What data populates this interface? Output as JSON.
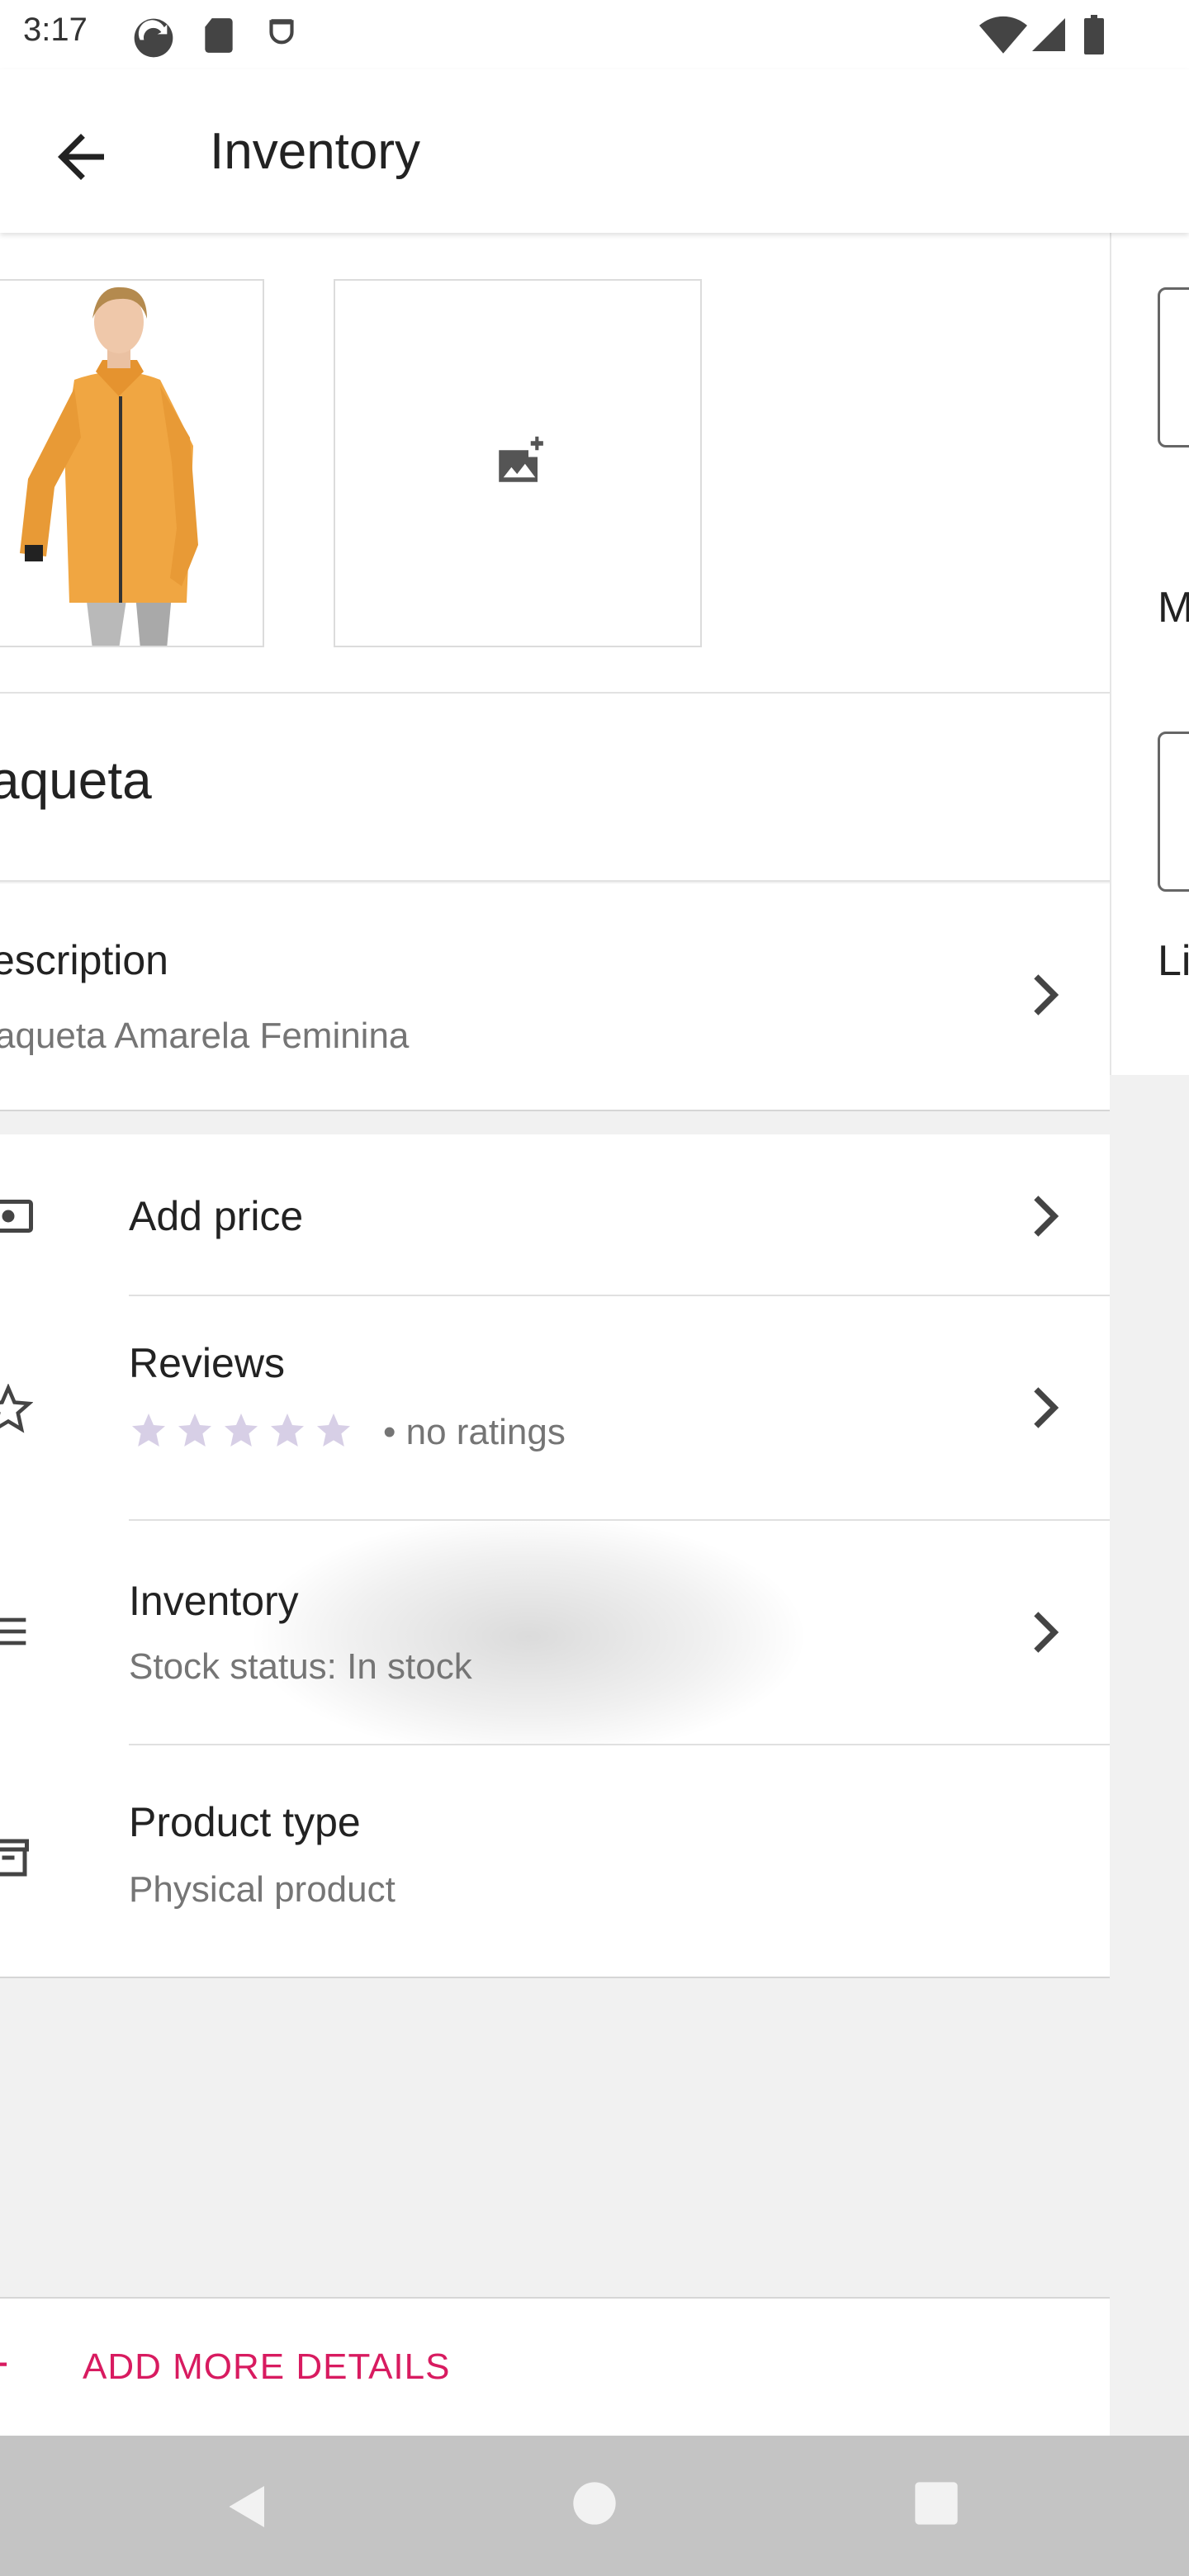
{
  "status_bar": {
    "time": "3:17",
    "icons": [
      "sync-icon",
      "sd-card-icon",
      "shield-icon",
      "wifi-icon",
      "signal-icon",
      "battery-icon"
    ]
  },
  "app_bar": {
    "title": "Inventory",
    "back_icon": "arrow-back-icon"
  },
  "photos": {
    "add_photo_icon": "add-photo-icon"
  },
  "product": {
    "title": "aqueta",
    "description_label": "escription",
    "description_value": "aqueta Amarela Feminina"
  },
  "rows": [
    {
      "label": "Add price",
      "icon": "price-tag-icon"
    },
    {
      "label": "Reviews",
      "icon": "star-outline-icon",
      "stars": 5,
      "ratings_text": "• no ratings"
    },
    {
      "label": "Inventory",
      "icon": "list-icon",
      "sub": "Stock status: In stock"
    },
    {
      "label": "Product type",
      "icon": "archive-icon",
      "sub": "Physical product"
    }
  ],
  "footer": {
    "add_more_label": "ADD MORE DETAILS",
    "plus": "+"
  },
  "right_panel": {
    "text_1": "M",
    "text_2": "Li"
  },
  "colors": {
    "accent": "#d81b60",
    "star": "#d7cfe6",
    "background": "#f1f1f1",
    "nav_bar": "#c4c4c4"
  },
  "nav_bar": {
    "buttons": [
      "nav-back-icon",
      "nav-home-icon",
      "nav-recents-icon"
    ]
  }
}
